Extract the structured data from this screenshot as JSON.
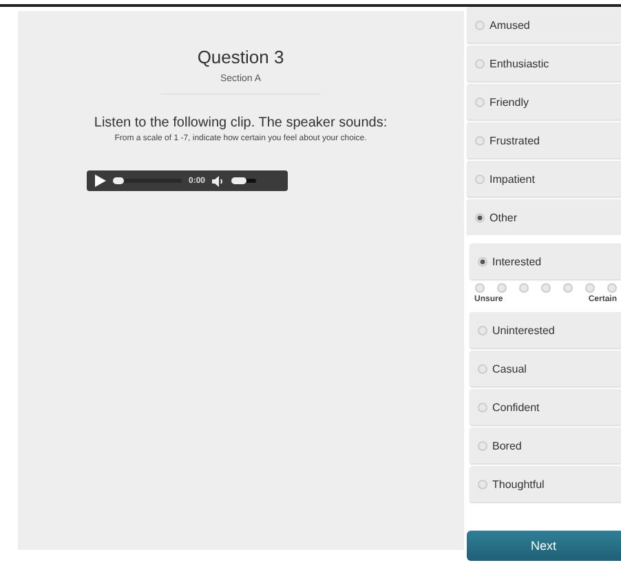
{
  "question": {
    "title": "Question 3",
    "section": "Section A",
    "prompt": "Listen to the following clip. The speaker sounds:",
    "instruction": "From a scale of 1 -7, indicate how certain you feel about your choice."
  },
  "player": {
    "time": "0:00",
    "progress": {
      "level": 0.02
    },
    "volume": {
      "level": 0.6
    }
  },
  "options": [
    {
      "label": "Amused",
      "selected": false
    },
    {
      "label": "Enthusiastic",
      "selected": false
    },
    {
      "label": "Friendly",
      "selected": false
    },
    {
      "label": "Frustrated",
      "selected": false
    },
    {
      "label": "Impatient",
      "selected": false
    },
    {
      "label": "Other",
      "selected": true,
      "children": [
        {
          "label": "Interested",
          "selected": true,
          "scale": {
            "points": [
              {
                "selected": false
              },
              {
                "selected": false
              },
              {
                "selected": false
              },
              {
                "selected": false
              },
              {
                "selected": false
              },
              {
                "selected": false
              },
              {
                "selected": false
              }
            ],
            "low_label": "Unsure",
            "high_label": "Certain"
          }
        },
        {
          "label": "Uninterested",
          "selected": false
        },
        {
          "label": "Casual",
          "selected": false
        },
        {
          "label": "Confident",
          "selected": false
        },
        {
          "label": "Bored",
          "selected": false
        },
        {
          "label": "Thoughtful",
          "selected": false
        }
      ]
    }
  ],
  "next_button": "Next"
}
